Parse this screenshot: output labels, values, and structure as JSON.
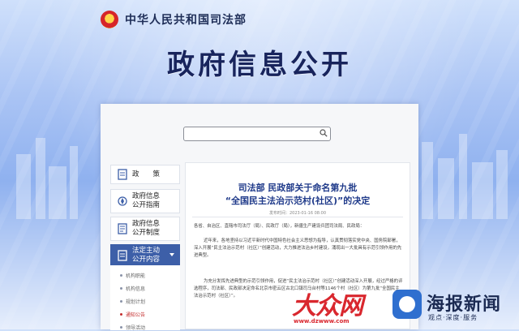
{
  "header": {
    "site_name": "中华人民共和国司法部"
  },
  "page": {
    "title": "政府信息公开"
  },
  "search": {
    "placeholder": ""
  },
  "sidebar": {
    "items": [
      {
        "label": "政　　策"
      },
      {
        "label": "政府信息\n公开指南"
      },
      {
        "label": "政府信息\n公开制度"
      },
      {
        "label": "法定主动\n公开内容"
      }
    ],
    "sub_items": [
      {
        "label": "机构职能"
      },
      {
        "label": "机构信息"
      },
      {
        "label": "规划计划"
      },
      {
        "label": "通知公告"
      },
      {
        "label": "领导活动"
      }
    ]
  },
  "article": {
    "title_line1": "司法部  民政部关于命名第九批",
    "title_line2": "“全国民主法治示范村(社区)”的决定",
    "meta": "发布时间：2023-01-16 08:00",
    "para1": "各省、自治区、直辖市司法厅（局）、民政厅（局），新疆生产建设兵团司法局、民政局：",
    "para2": "近年来，各地坚持以习近平新时代中国特色社会主义思想为指导，认真贯彻落实党中央、国务院部署，深入开展“民主法治示范村（社区）”创建活动，大力推进法治乡村建设，涌现出一大批具有示范引领作用的先进典型。",
    "para3": "为充分发挥先进典型的示范引领作用，促进“民主法治示范村（社区）”创建活动深入开展，经过严格的评选程序，司法部、民政部决定命名北京市密云区古北口镇司马台村等1146个村（社区）为第九批“全国民主法治示范村（社区）”。"
  },
  "watermark": {
    "brand1": "大众网",
    "brand1_url": "www.dzwww.com",
    "brand2": "海报新闻",
    "brand2_sub": "观点·深度·服务"
  },
  "colors": {
    "accent": "#3d5fa8",
    "title_blue": "#1f3a8a",
    "brand_red": "#d9272e"
  }
}
